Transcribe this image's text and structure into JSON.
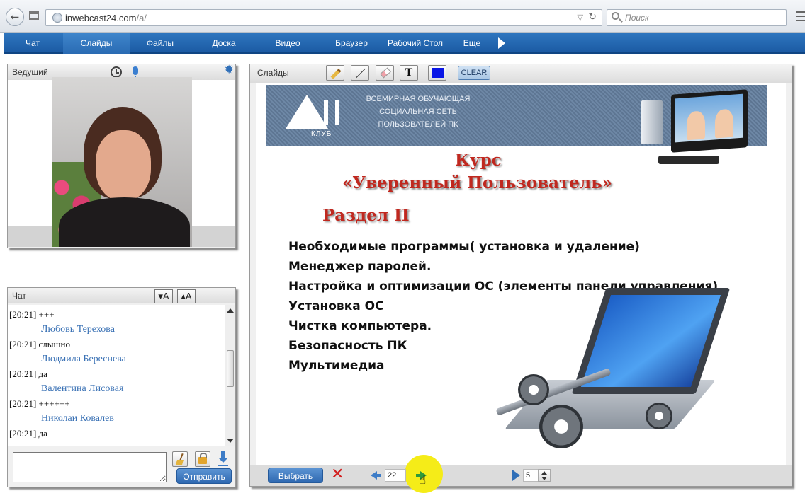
{
  "browser": {
    "url_host": "inwebcast24.com",
    "url_path": "/a/",
    "search_placeholder": "Поиск"
  },
  "nav": {
    "items": [
      {
        "label": "Чат"
      },
      {
        "label": "Слайды"
      },
      {
        "label": "Файлы"
      },
      {
        "label": "Доска"
      },
      {
        "label": "Видео"
      },
      {
        "label": "Браузер"
      },
      {
        "label": "Рабочий Стол"
      },
      {
        "label": "Еще"
      }
    ],
    "active": "Слайды"
  },
  "presenter": {
    "title": "Ведущий"
  },
  "chat": {
    "title": "Чат",
    "font_decrease": "▾A",
    "font_increase": "▴A",
    "messages": [
      {
        "time": "[20:21]",
        "text": "+++",
        "user": "Любовь Терехова"
      },
      {
        "time": "[20:21]",
        "text": "слышно",
        "user": "Людмила Береснева"
      },
      {
        "time": "[20:21]",
        "text": "да",
        "user": "Валентина Лисовая"
      },
      {
        "time": "[20:21]",
        "text": "++++++",
        "user": "Николаи Ковалев"
      },
      {
        "time": "[20:21]",
        "text": "да",
        "user": ""
      }
    ],
    "send_label": "Отправить"
  },
  "slides": {
    "title": "Слайды",
    "text_tool": "T",
    "clear_label": "CLEAR",
    "pen_color": "#0a16e6",
    "select_label": "Выбрать",
    "page_number": "22",
    "interval": "5"
  },
  "slide": {
    "banner_lines": [
      "ВСЕМИРНАЯ ОБУЧАЮЩАЯ",
      "СОЦИАЛЬНАЯ СЕТЬ",
      "ПОЛЬЗОВАТЕЛЕЙ ПК"
    ],
    "logo_club": "КЛУБ",
    "title_course": "Курс",
    "title_name": "«Уверенный Пользователь»",
    "section": "Раздел II",
    "bullets": [
      "Необходимые программы( установка и удаление)",
      " Менеджер паролей.",
      "Настройка и оптимизации ОС (элементы  панели управления)",
      "Установка ОС",
      " Чистка компьютера.",
      "Безопасность ПК",
      "Мультимедиа"
    ]
  }
}
